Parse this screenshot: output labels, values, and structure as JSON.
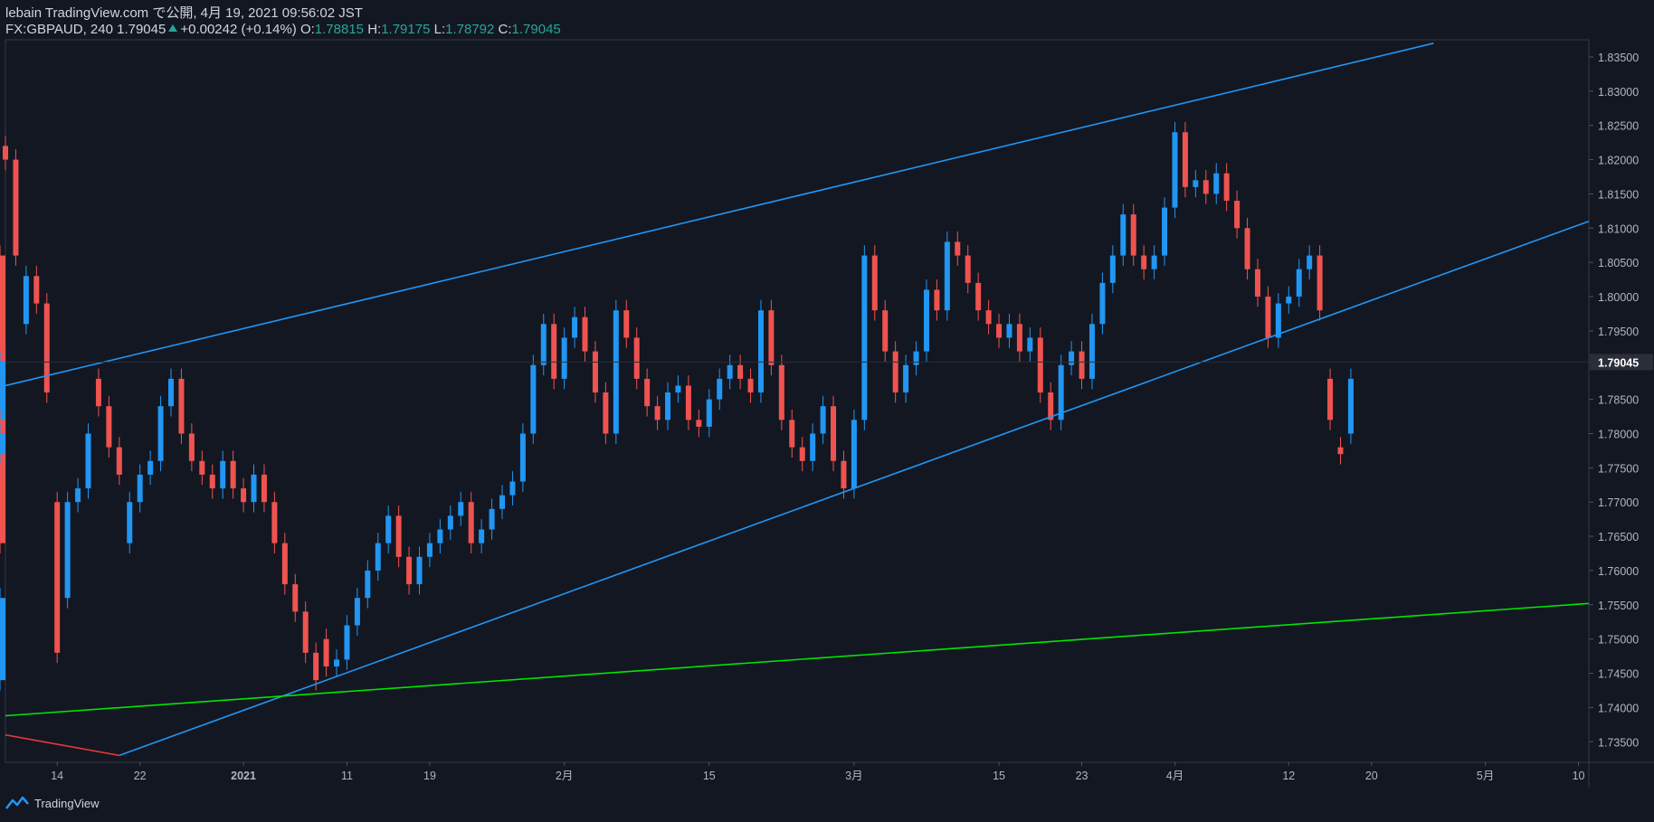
{
  "header": {
    "line1": "lebain TradingView.com で公開, 4月 19, 2021 09:56:02 JST",
    "symbol": "FX:GBPAUD, 240",
    "last": "1.79045",
    "change": "+0.00242 (+0.14%)",
    "o_label": "O:",
    "o": "1.78815",
    "h_label": "H:",
    "h": "1.79175",
    "l_label": "L:",
    "l": "1.78792",
    "c_label": "C:",
    "c": "1.79045"
  },
  "footer": {
    "brand": "TradingView",
    "logo_icon": "tradingview-logo-icon"
  },
  "colors": {
    "background": "#131722",
    "up": "#2196f3",
    "down": "#ef5350",
    "channel": "#2196f3",
    "support": "#00e600",
    "red_line": "#e53935",
    "axis_text": "#b2b5be",
    "border": "#363a45"
  },
  "chart_data": {
    "type": "candlestick",
    "symbol": "FX:GBPAUD",
    "timeframe": "240",
    "y_range": [
      1.732,
      1.8375
    ],
    "y_ticks": [
      "1.83500",
      "1.83000",
      "1.82500",
      "1.82000",
      "1.81500",
      "1.81000",
      "1.80500",
      "1.80000",
      "1.79500",
      "1.79045",
      "1.78500",
      "1.78000",
      "1.77500",
      "1.77000",
      "1.76500",
      "1.76000",
      "1.75500",
      "1.75000",
      "1.74500",
      "1.74000",
      "1.73500"
    ],
    "last_price": "1.79045",
    "x_range": [
      "2020-12-09",
      "2021-05-11"
    ],
    "x_ticks": [
      {
        "label": "14",
        "date": "2020-12-14"
      },
      {
        "label": "22",
        "date": "2020-12-22"
      },
      {
        "label": "2021",
        "date": "2021-01-01"
      },
      {
        "label": "11",
        "date": "2021-01-11"
      },
      {
        "label": "19",
        "date": "2021-01-19"
      },
      {
        "label": "2月",
        "date": "2021-02-01"
      },
      {
        "label": "15",
        "date": "2021-02-15"
      },
      {
        "label": "3月",
        "date": "2021-03-01"
      },
      {
        "label": "15",
        "date": "2021-03-15"
      },
      {
        "label": "23",
        "date": "2021-03-23"
      },
      {
        "label": "4月",
        "date": "2021-04-01"
      },
      {
        "label": "12",
        "date": "2021-04-12"
      },
      {
        "label": "20",
        "date": "2021-04-20"
      },
      {
        "label": "5月",
        "date": "2021-05-01"
      },
      {
        "label": "10",
        "date": "2021-05-10"
      }
    ],
    "closes": [
      [
        "2020-12-09",
        1.82
      ],
      [
        "2020-12-10",
        1.806
      ],
      [
        "2020-12-10T12",
        1.796
      ],
      [
        "2020-12-11",
        1.803
      ],
      [
        "2020-12-12",
        1.799
      ],
      [
        "2020-12-13",
        1.786
      ],
      [
        "2020-12-13T12",
        1.77
      ],
      [
        "2020-12-14",
        1.748
      ],
      [
        "2020-12-14T12",
        1.756
      ],
      [
        "2020-12-15",
        1.77
      ],
      [
        "2020-12-16",
        1.772
      ],
      [
        "2020-12-17",
        1.78
      ],
      [
        "2020-12-17T12",
        1.788
      ],
      [
        "2020-12-18",
        1.784
      ],
      [
        "2020-12-19",
        1.778
      ],
      [
        "2020-12-20",
        1.774
      ],
      [
        "2020-12-20T12",
        1.764
      ],
      [
        "2020-12-21",
        1.77
      ],
      [
        "2020-12-22",
        1.774
      ],
      [
        "2020-12-23",
        1.776
      ],
      [
        "2020-12-24",
        1.784
      ],
      [
        "2020-12-25",
        1.788
      ],
      [
        "2020-12-26",
        1.78
      ],
      [
        "2020-12-27",
        1.776
      ],
      [
        "2020-12-28",
        1.774
      ],
      [
        "2020-12-29",
        1.772
      ],
      [
        "2020-12-30",
        1.776
      ],
      [
        "2020-12-31",
        1.772
      ],
      [
        "2021-01-01",
        1.77
      ],
      [
        "2021-01-02",
        1.774
      ],
      [
        "2021-01-03",
        1.77
      ],
      [
        "2021-01-04",
        1.764
      ],
      [
        "2021-01-05",
        1.758
      ],
      [
        "2021-01-06",
        1.754
      ],
      [
        "2021-01-07",
        1.748
      ],
      [
        "2021-01-08",
        1.744
      ],
      [
        "2021-01-08T12",
        1.75
      ],
      [
        "2021-01-09",
        1.746
      ],
      [
        "2021-01-10",
        1.747
      ],
      [
        "2021-01-11",
        1.752
      ],
      [
        "2021-01-12",
        1.756
      ],
      [
        "2021-01-13",
        1.76
      ],
      [
        "2021-01-14",
        1.764
      ],
      [
        "2021-01-15",
        1.768
      ],
      [
        "2021-01-16",
        1.762
      ],
      [
        "2021-01-17",
        1.758
      ],
      [
        "2021-01-18",
        1.762
      ],
      [
        "2021-01-19",
        1.764
      ],
      [
        "2021-01-20",
        1.766
      ],
      [
        "2021-01-21",
        1.768
      ],
      [
        "2021-01-22",
        1.77
      ],
      [
        "2021-01-23",
        1.764
      ],
      [
        "2021-01-24",
        1.766
      ],
      [
        "2021-01-25",
        1.769
      ],
      [
        "2021-01-26",
        1.771
      ],
      [
        "2021-01-27",
        1.773
      ],
      [
        "2021-01-28",
        1.78
      ],
      [
        "2021-01-29",
        1.79
      ],
      [
        "2021-01-30",
        1.796
      ],
      [
        "2021-01-31",
        1.788
      ],
      [
        "2021-02-01",
        1.794
      ],
      [
        "2021-02-02",
        1.797
      ],
      [
        "2021-02-03",
        1.792
      ],
      [
        "2021-02-04",
        1.786
      ],
      [
        "2021-02-05",
        1.78
      ],
      [
        "2021-02-06",
        1.798
      ],
      [
        "2021-02-07",
        1.794
      ],
      [
        "2021-02-08",
        1.788
      ],
      [
        "2021-02-09",
        1.784
      ],
      [
        "2021-02-10",
        1.782
      ],
      [
        "2021-02-11",
        1.786
      ],
      [
        "2021-02-12",
        1.787
      ],
      [
        "2021-02-13",
        1.782
      ],
      [
        "2021-02-14",
        1.781
      ],
      [
        "2021-02-15",
        1.785
      ],
      [
        "2021-02-16",
        1.788
      ],
      [
        "2021-02-17",
        1.79
      ],
      [
        "2021-02-18",
        1.788
      ],
      [
        "2021-02-19",
        1.786
      ],
      [
        "2021-02-20",
        1.798
      ],
      [
        "2021-02-21",
        1.79
      ],
      [
        "2021-02-22",
        1.782
      ],
      [
        "2021-02-23",
        1.778
      ],
      [
        "2021-02-24",
        1.776
      ],
      [
        "2021-02-25",
        1.78
      ],
      [
        "2021-02-26",
        1.784
      ],
      [
        "2021-02-27",
        1.776
      ],
      [
        "2021-02-28",
        1.772
      ],
      [
        "2021-03-01",
        1.782
      ],
      [
        "2021-03-02",
        1.806
      ],
      [
        "2021-03-03",
        1.798
      ],
      [
        "2021-03-04",
        1.792
      ],
      [
        "2021-03-05",
        1.786
      ],
      [
        "2021-03-06",
        1.79
      ],
      [
        "2021-03-07",
        1.792
      ],
      [
        "2021-03-08",
        1.801
      ],
      [
        "2021-03-09",
        1.798
      ],
      [
        "2021-03-10",
        1.808
      ],
      [
        "2021-03-11",
        1.806
      ],
      [
        "2021-03-12",
        1.802
      ],
      [
        "2021-03-13",
        1.798
      ],
      [
        "2021-03-14",
        1.796
      ],
      [
        "2021-03-15",
        1.794
      ],
      [
        "2021-03-16",
        1.796
      ],
      [
        "2021-03-17",
        1.792
      ],
      [
        "2021-03-18",
        1.794
      ],
      [
        "2021-03-19",
        1.786
      ],
      [
        "2021-03-20",
        1.782
      ],
      [
        "2021-03-21",
        1.79
      ],
      [
        "2021-03-22",
        1.792
      ],
      [
        "2021-03-23",
        1.788
      ],
      [
        "2021-03-24",
        1.796
      ],
      [
        "2021-03-25",
        1.802
      ],
      [
        "2021-03-26",
        1.806
      ],
      [
        "2021-03-27",
        1.812
      ],
      [
        "2021-03-28",
        1.806
      ],
      [
        "2021-03-29",
        1.804
      ],
      [
        "2021-03-30",
        1.806
      ],
      [
        "2021-03-31",
        1.813
      ],
      [
        "2021-04-01",
        1.824
      ],
      [
        "2021-04-02",
        1.816
      ],
      [
        "2021-04-03",
        1.817
      ],
      [
        "2021-04-04",
        1.815
      ],
      [
        "2021-04-05",
        1.818
      ],
      [
        "2021-04-06",
        1.814
      ],
      [
        "2021-04-07",
        1.81
      ],
      [
        "2021-04-08",
        1.804
      ],
      [
        "2021-04-09",
        1.8
      ],
      [
        "2021-04-10",
        1.794
      ],
      [
        "2021-04-11",
        1.799
      ],
      [
        "2021-04-12",
        1.8
      ],
      [
        "2021-04-13",
        1.804
      ],
      [
        "2021-04-14",
        1.806
      ],
      [
        "2021-04-15",
        1.798
      ],
      [
        "2021-04-15T12",
        1.788
      ],
      [
        "2021-04-16",
        1.782
      ],
      [
        "2021-04-16T12",
        1.778
      ],
      [
        "2021-04-17",
        1.777
      ],
      [
        "2021-04-17T12",
        1.78
      ],
      [
        "2021-04-18",
        1.788
      ],
      [
        "2021-04-18T12",
        1.7905
      ]
    ],
    "trendlines": [
      {
        "name": "channel-upper",
        "color": "#2196f3",
        "from": [
          "2020-12-09",
          1.787
        ],
        "to": [
          "2021-04-26",
          1.837
        ]
      },
      {
        "name": "channel-lower",
        "color": "#2196f3",
        "from": [
          "2020-12-20",
          1.733
        ],
        "to": [
          "2021-05-11",
          1.811
        ]
      },
      {
        "name": "support",
        "color": "#00e600",
        "from": [
          "2020-12-09",
          1.7388
        ],
        "to": [
          "2021-05-11",
          1.7552
        ]
      },
      {
        "name": "red-line",
        "color": "#e53935",
        "from": [
          "2020-12-09",
          1.736
        ],
        "to": [
          "2020-12-20",
          1.733
        ]
      }
    ]
  }
}
